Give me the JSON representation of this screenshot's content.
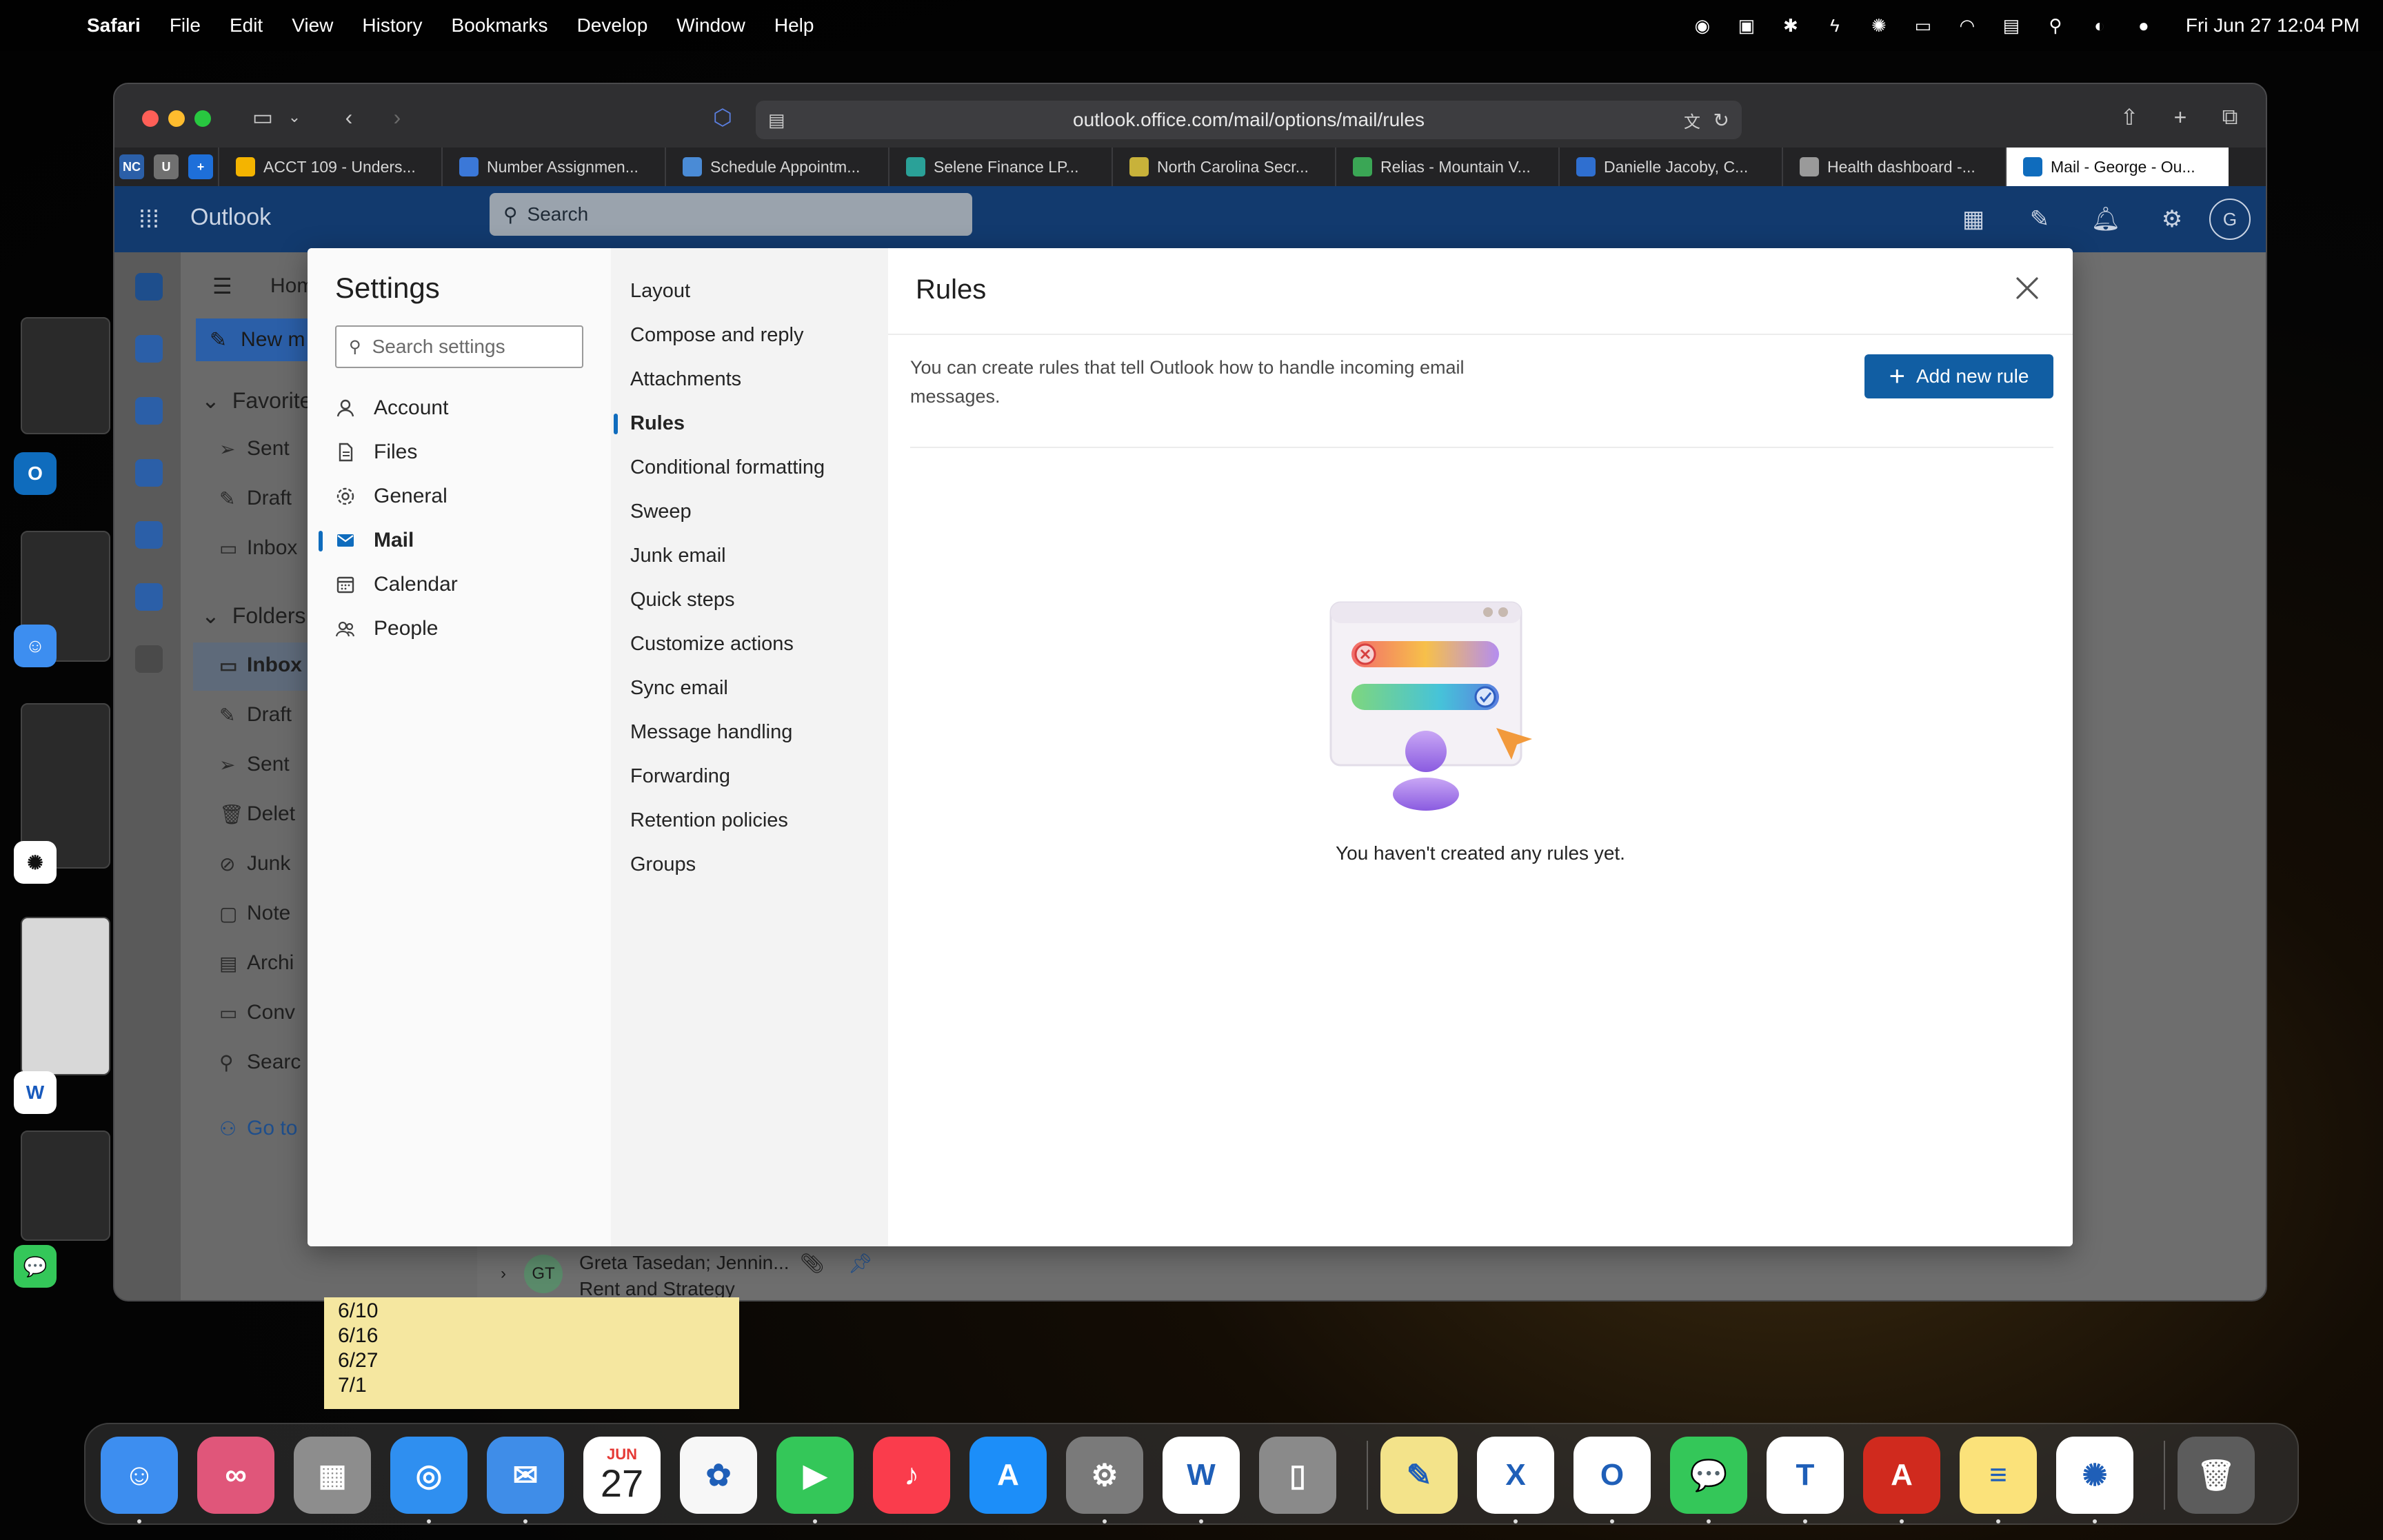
{
  "menubar": {
    "app_name": "Safari",
    "items": [
      "File",
      "Edit",
      "View",
      "History",
      "Bookmarks",
      "Develop",
      "Window",
      "Help"
    ],
    "clock": "Fri Jun 27  12:04 PM"
  },
  "browser": {
    "url": "outlook.office.com/mail/options/mail/rules",
    "pinned_tabs": [
      {
        "label": "NC",
        "color": "#2b5fa8"
      },
      {
        "label": "U",
        "color": "#707070"
      },
      {
        "label": "+",
        "color": "#1e6fd9"
      }
    ],
    "tabs": [
      {
        "label": "ACCT 109 - Unders...",
        "color": "#f4b400"
      },
      {
        "label": "Number Assignmen...",
        "color": "#3b78d8"
      },
      {
        "label": "Schedule Appointm...",
        "color": "#4a8bd6"
      },
      {
        "label": "Selene Finance LP...",
        "color": "#2aa198"
      },
      {
        "label": "North Carolina Secr...",
        "color": "#c8b23a"
      },
      {
        "label": "Relias - Mountain V...",
        "color": "#3aa655"
      },
      {
        "label": "Danielle Jacoby, C...",
        "color": "#2f6fd0"
      },
      {
        "label": "Health dashboard -...",
        "color": "#9a9a9a"
      },
      {
        "label": "Mail - George - Ou...",
        "color": "#0f6cbd"
      }
    ]
  },
  "outlook": {
    "brand": "Outlook",
    "search_placeholder": "Search",
    "avatar_initial": "G",
    "nav": {
      "home_tab": "Hom",
      "new_mail": "New m",
      "favorites": "Favorite",
      "fav_items": [
        "Sent",
        "Draft",
        "Inbox"
      ],
      "folders": "Folders",
      "folder_items": [
        "Inbox",
        "Draft",
        "Sent",
        "Delet",
        "Junk",
        "Note",
        "Archi",
        "Conv",
        "Searc"
      ],
      "go_to": "Go to"
    },
    "list_row": {
      "initials": "GT",
      "sender": "Greta Tasedan; Jennin...",
      "subject": "Rent and Strategy"
    }
  },
  "sticky_note": {
    "lines": [
      "6/10",
      "6/16",
      "6/27",
      "7/1"
    ]
  },
  "settings": {
    "title": "Settings",
    "search_placeholder": "Search settings",
    "categories": [
      {
        "label": "Account",
        "icon": "person-icon"
      },
      {
        "label": "Files",
        "icon": "document-icon"
      },
      {
        "label": "General",
        "icon": "gear-icon"
      },
      {
        "label": "Mail",
        "icon": "mail-icon",
        "active": true
      },
      {
        "label": "Calendar",
        "icon": "calendar-icon"
      },
      {
        "label": "People",
        "icon": "people-icon"
      }
    ],
    "mail_sections": [
      "Layout",
      "Compose and reply",
      "Attachments",
      "Rules",
      "Conditional formatting",
      "Sweep",
      "Junk email",
      "Quick steps",
      "Customize actions",
      "Sync email",
      "Message handling",
      "Forwarding",
      "Retention policies",
      "Groups"
    ],
    "active_section": "Rules",
    "rules": {
      "title": "Rules",
      "description": "You can create rules that tell Outlook how to handle incoming email messages.",
      "add_button": "Add new rule",
      "empty_message": "You haven't created any rules yet."
    }
  },
  "dock": {
    "calendar_month": "JUN",
    "calendar_day": "27",
    "apps": [
      {
        "name": "finder",
        "color": "#3d8ef0",
        "glyph": "☺"
      },
      {
        "name": "creative-cloud",
        "color": "#e0567a",
        "glyph": "∞"
      },
      {
        "name": "launchpad",
        "color": "#8d8d8d",
        "glyph": "▦"
      },
      {
        "name": "safari",
        "color": "#2f8ff0",
        "glyph": "◎"
      },
      {
        "name": "mail",
        "color": "#3f8de8",
        "glyph": "✉"
      },
      {
        "name": "calendar",
        "color": "#ffffff",
        "glyph": ""
      },
      {
        "name": "photos",
        "color": "#f7f7f7",
        "glyph": "✿"
      },
      {
        "name": "facetime",
        "color": "#34c759",
        "glyph": "▶"
      },
      {
        "name": "music",
        "color": "#fa3c4c",
        "glyph": "♪"
      },
      {
        "name": "app-store",
        "color": "#1c8ef9",
        "glyph": "A"
      },
      {
        "name": "system-settings",
        "color": "#7a7a7a",
        "glyph": "⚙"
      },
      {
        "name": "word",
        "color": "#ffffff",
        "glyph": "W"
      },
      {
        "name": "iphone-mirroring",
        "color": "#8a8a8a",
        "glyph": "▯"
      },
      {
        "name": "stickies",
        "color": "#f3e38a",
        "glyph": "✎"
      },
      {
        "name": "excel",
        "color": "#ffffff",
        "glyph": "X"
      },
      {
        "name": "outlook",
        "color": "#ffffff",
        "glyph": "O"
      },
      {
        "name": "messages",
        "color": "#34c759",
        "glyph": "💬"
      },
      {
        "name": "teams",
        "color": "#ffffff",
        "glyph": "T"
      },
      {
        "name": "acrobat",
        "color": "#d02a1e",
        "glyph": "A"
      },
      {
        "name": "notes",
        "color": "#fbe27a",
        "glyph": "≡"
      },
      {
        "name": "chatgpt",
        "color": "#ffffff",
        "glyph": "✺"
      },
      {
        "name": "trash",
        "color": "#5c5c5c",
        "glyph": "🗑"
      }
    ]
  }
}
